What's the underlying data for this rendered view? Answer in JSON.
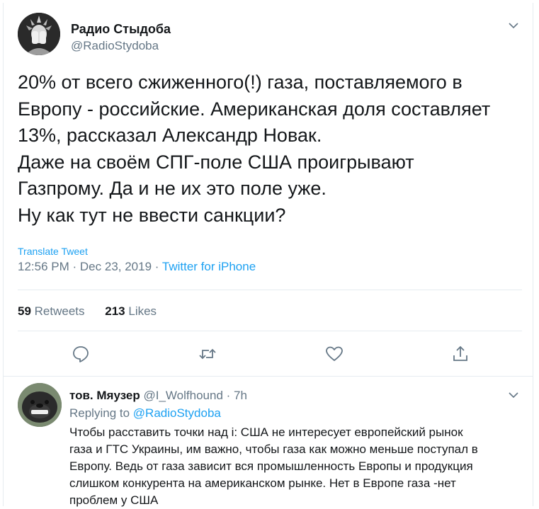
{
  "tweet": {
    "author_name": "Радио Стыдоба",
    "author_handle": "@RadioStydoba",
    "lines": [
      "20% от всего сжиженного(!) газа, поставляемого в",
      "Европу - российские. Американская доля составляет",
      "13%, рассказал Александр Новак.",
      "Даже на своём СПГ-поле США проигрывают",
      "Газпрому. Да и не их это поле уже.",
      "Ну как тут не ввести санкции?"
    ],
    "translate": "Translate Tweet",
    "time": "12:56 PM",
    "date": "Dec 23, 2019",
    "dot": "·",
    "source": "Twitter for iPhone",
    "retweets_count": "59",
    "retweets_label": "Retweets",
    "likes_count": "213",
    "likes_label": "Likes"
  },
  "actions": [
    {
      "icon": "reply-icon"
    },
    {
      "icon": "retweet-icon"
    },
    {
      "icon": "like-icon"
    },
    {
      "icon": "share-icon"
    }
  ],
  "reply": {
    "author_name": "тов. Мяузер",
    "author_handle": "@I_Wolfhound",
    "time": "· 7h",
    "replying_prefix": "Replying to",
    "replying_to": "@RadioStydoba",
    "lines": [
      "Чтобы расставить точки над i: США не интересует европейский рынок",
      "газа и ГТС Украины, им важно, чтобы газа как можно меньше поступал в",
      "Европу. Ведь от газа зависит вся промышленность Европы и продукция",
      "слишком конкурента на американском рынке. Нет в Европе газа -нет",
      "проблем у США"
    ]
  },
  "colors": {
    "accent": "#1da1f2",
    "secondary_text": "#657786",
    "primary_text": "#14171a",
    "divider": "#e6ecf0"
  }
}
